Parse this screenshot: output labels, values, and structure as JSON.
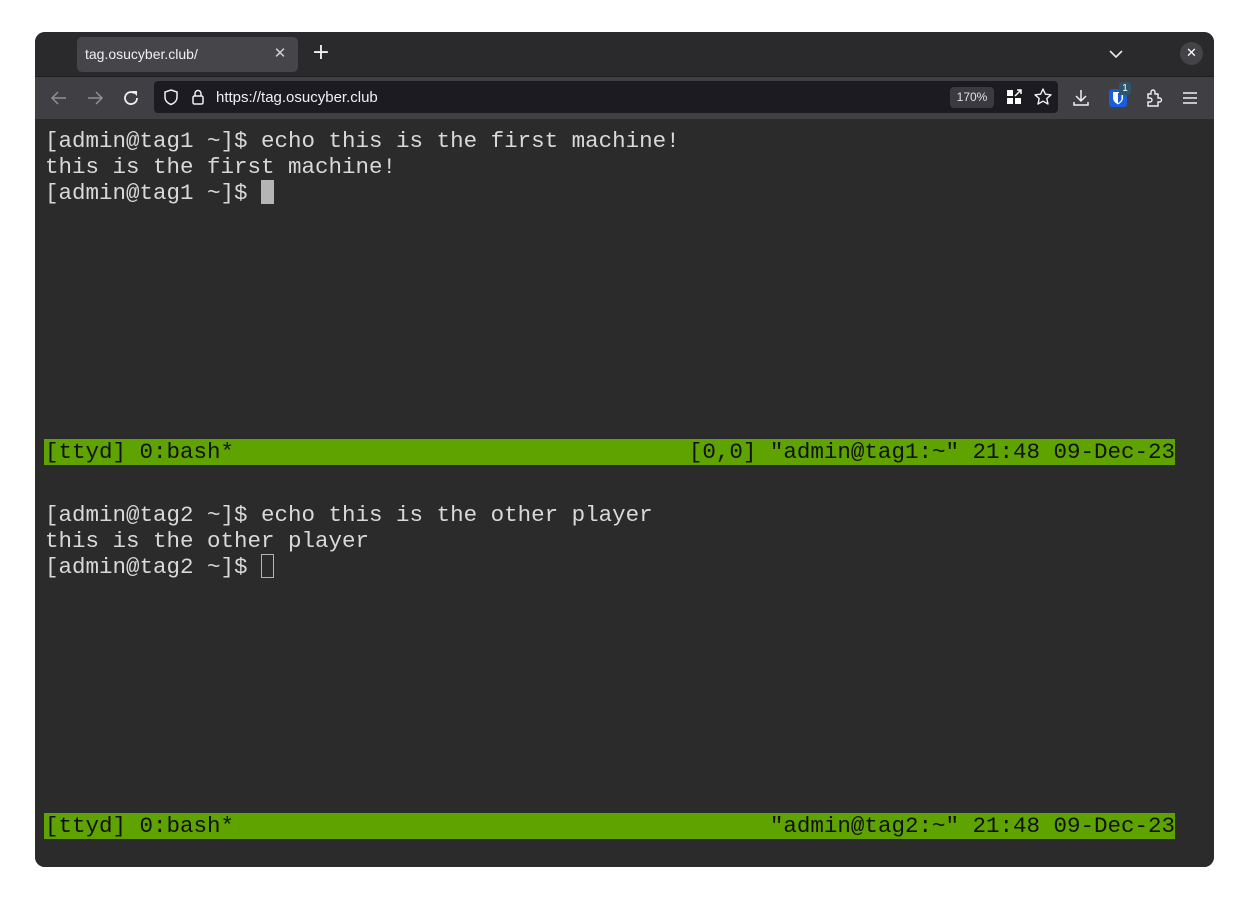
{
  "browser": {
    "tab": {
      "title": "tag.osucyber.club/",
      "close_icon": "close-icon"
    },
    "new_tab_icon": "plus-icon",
    "tab_list_icon": "chevron-down-icon",
    "window_close_icon": "close-icon",
    "nav": {
      "back_icon": "arrow-left-icon",
      "forward_icon": "arrow-right-icon",
      "reload_icon": "reload-icon"
    },
    "urlbar": {
      "url": "https://tag.osucyber.club",
      "zoom": "170%",
      "shield_icon": "shield-icon",
      "lock_icon": "lock-icon"
    },
    "toolbar": {
      "extension_badge": "1",
      "icons": [
        "qr-code-icon",
        "bookmark-star-icon",
        "download-icon",
        "bitwarden-icon",
        "extensions-icon",
        "menu-icon"
      ]
    }
  },
  "terminal": {
    "colors": {
      "status_bg": "#5fa300",
      "bg": "#2b2b2b",
      "fg": "#d9d9d9"
    },
    "panes": [
      {
        "lines": [
          "[admin@tag1 ~]$ echo this is the first machine!",
          "this is the first machine!",
          "[admin@tag1 ~]$ "
        ],
        "status_left": "[ttyd] 0:bash*",
        "status_right": "[0,0] \"admin@tag1:~\" 21:48 09-Dec-23"
      },
      {
        "lines": [
          "[admin@tag2 ~]$ echo this is the other player",
          "this is the other player",
          "[admin@tag2 ~]$ "
        ],
        "status_left": "[ttyd] 0:bash*",
        "status_right": "\"admin@tag2:~\" 21:48 09-Dec-23"
      }
    ]
  }
}
